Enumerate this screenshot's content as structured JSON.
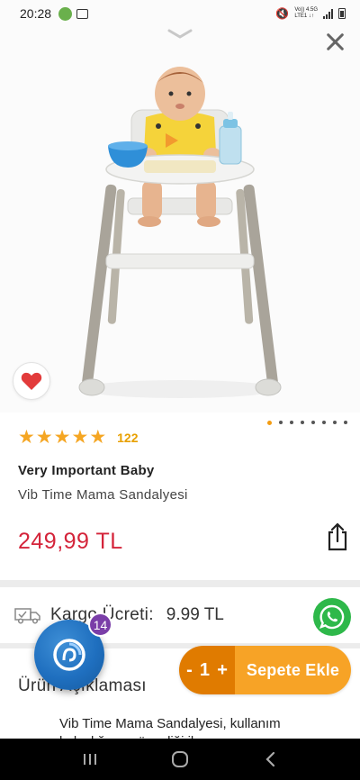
{
  "status_bar": {
    "time": "20:28",
    "network_top": "Vo)) 4.5G",
    "network_bottom": "LTE1 ↓↑"
  },
  "product": {
    "rating_stars": 5,
    "review_count": "122",
    "brand": "Very Important Baby",
    "name": "Vib Time Mama Sandalyesi",
    "price": "249,99 TL",
    "image_count": 8,
    "active_image": 1
  },
  "shipping": {
    "label": "Kargo Ücreti:",
    "value": "9.99 TL"
  },
  "chat": {
    "badge": "14"
  },
  "cart": {
    "minus": "-",
    "quantity": "1",
    "plus": "+",
    "add_label": "Sepete Ekle"
  },
  "description": {
    "title": "Ürün Açıklaması",
    "items": [
      "Vib Time Mama Sandalyesi, kullanım kolaylığı ve güvenliği ile"
    ]
  },
  "colors": {
    "price_red": "#d4243a",
    "star_orange": "#f5a623",
    "cart_dark": "#e07b00",
    "cart_light": "#f7a326",
    "whatsapp_green": "#2eb84a",
    "chat_blue": "#1f6fbf",
    "badge_purple": "#7a3ea8"
  },
  "icons": {
    "heart": "heart-icon",
    "share": "share-icon",
    "close": "close-icon",
    "chevron": "chevron-down-icon",
    "truck": "truck-icon",
    "whatsapp": "whatsapp-icon"
  }
}
